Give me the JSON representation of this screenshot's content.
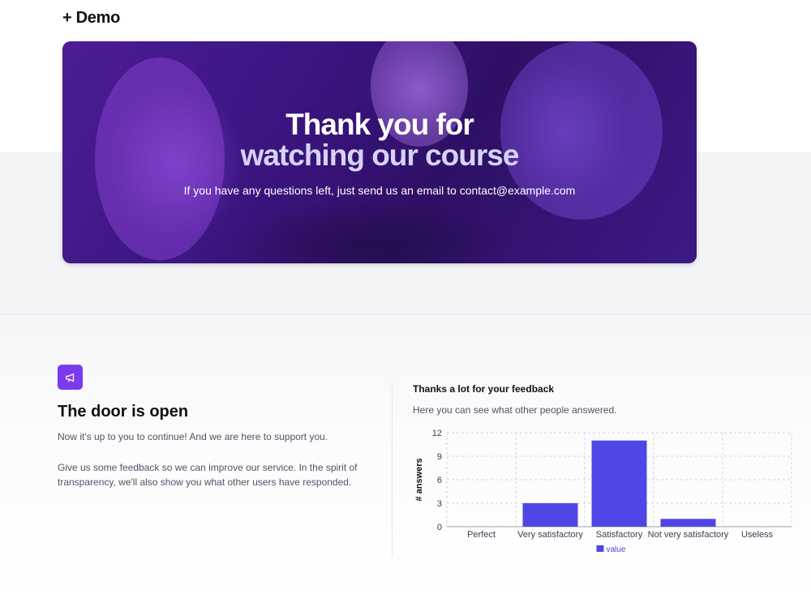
{
  "brand": {
    "name": "+ Demo"
  },
  "hero": {
    "title_line1": "Thank you for",
    "title_line2": "watching our course",
    "subtitle": "If you have any questions left, just send us an email to contact@example.com"
  },
  "door": {
    "icon": "megaphone-icon",
    "title": "The door is open",
    "paragraph1": "Now it's up to you to continue! And we are here to support you.",
    "paragraph2": "Give us some feedback so we can improve our service. In the spirit of transparency, we'll also show you what other users have responded."
  },
  "feedback": {
    "title": "Thanks a lot for your feedback",
    "subtitle": "Here you can see what other people answered."
  },
  "colors": {
    "accent": "#7c3aed",
    "bar": "#4f46e5"
  },
  "chart_data": {
    "type": "bar",
    "categories": [
      "Perfect",
      "Very satisfactory",
      "Satisfactory",
      "Not very satisfactory",
      "Useless"
    ],
    "series": [
      {
        "name": "value",
        "values": [
          0,
          3,
          11,
          1,
          0
        ]
      }
    ],
    "ylabel": "# answers",
    "xlabel": "",
    "ylim": [
      0,
      12
    ],
    "yticks": [
      0,
      3,
      6,
      9,
      12
    ],
    "grid": true,
    "legend": "bottom"
  }
}
